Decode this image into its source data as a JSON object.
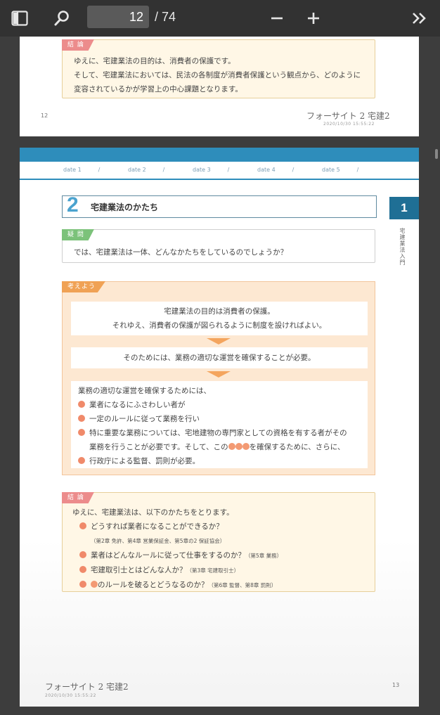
{
  "toolbar": {
    "current_page": "12",
    "total_pages": "/ 74"
  },
  "page12": {
    "tag": "結 論",
    "lines": [
      "ゆえに、宅建業法の目的は、消費者の保護です。",
      "そして、宅建業法においては、民法の各制度が消費者保護という観点から、どのように",
      "変容されているかが学習上の中心課題となります。"
    ],
    "page_number": "12",
    "footer_title": "フォーサイト 2 宅建2",
    "footer_date": "2020/10/30 15:55:22"
  },
  "page13": {
    "date_labels": [
      "date 1",
      "date 2",
      "date 3",
      "date 4",
      "date 5"
    ],
    "section_number": "2",
    "section_title": "宅建業法のかたち",
    "side_tab_number": "1",
    "side_tab_text": "宅建業法入門",
    "question": {
      "tag": "疑 問",
      "text": "では、宅建業法は一体、どんなかたちをしているのでしょうか？"
    },
    "think": {
      "tag": "考えよう",
      "box1": [
        "宅建業法の目的は消費者の保護。",
        "それゆえ、消費者の保護が図られるように制度を設ければよい。"
      ],
      "box2": "そのためには、業務の適切な運営を確保することが必要。",
      "box3_intro": "業務の適切な運営を確保するためには、",
      "box3_items": [
        "業者になるにふさわしい者が",
        "一定のルールに従って業務を行い",
        "特に重要な業務については、宅地建物の専門家としての資格を有する者がその",
        "業務を行うことが必要です。そして、この",
        "を確保するために、さらに、",
        "行政庁による監督、罰則が必要。"
      ]
    },
    "conclusion": {
      "tag": "結 論",
      "intro": "ゆえに、宅建業法は、以下のかたちをとります。",
      "item1": "どうすれば業者になることができるか？",
      "item1_note": "（第2章 免許、第4章 営業保証金、第5章の2 保証協会）",
      "item2": "業者はどんなルールに従って仕事をするのか？",
      "item2_note": "（第5章 業務）",
      "item3": "宅建取引士とはどんな人か？",
      "item3_note": "（第3章 宅建取引士）",
      "item4": "のルールを破るとどうなるのか？",
      "item4_note": "（第6章 監督、第8章 罰則）"
    },
    "footer_title": "フォーサイト 2 宅建2",
    "footer_date": "2020/10/30 15:55:22",
    "page_number": "13"
  }
}
